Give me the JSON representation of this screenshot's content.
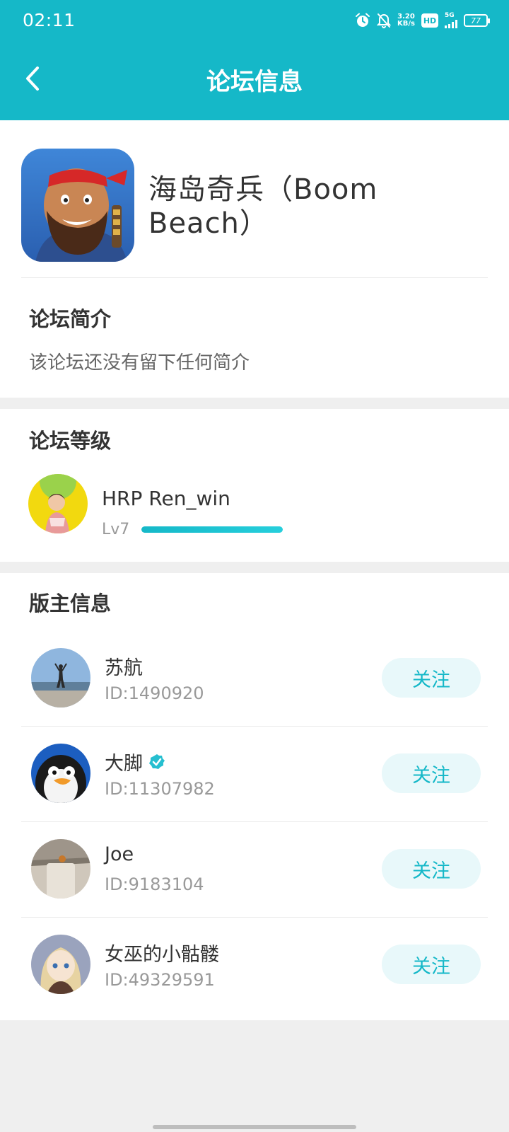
{
  "status_bar": {
    "time": "02:11",
    "net_speed_value": "3.20",
    "net_speed_unit": "KB/s",
    "hd_label": "HD",
    "signal_label": "5G",
    "battery": "77",
    "icons": [
      "alarm-icon",
      "bell-off-icon",
      "signal-icon",
      "battery-icon"
    ]
  },
  "header": {
    "title": "论坛信息",
    "back_icon": "chevron-left-icon"
  },
  "forum": {
    "name": "海岛奇兵（Boom Beach）",
    "intro_title": "论坛简介",
    "intro_text": "该论坛还没有留下任何简介"
  },
  "level": {
    "title": "论坛等级",
    "user_name": "HRP Ren_win",
    "level_label": "Lv7",
    "progress": 1.0
  },
  "moderators": {
    "title": "版主信息",
    "items": [
      {
        "name": "苏航",
        "id": "ID:1490920",
        "verified": false,
        "follow_label": "关注"
      },
      {
        "name": "大脚",
        "id": "ID:11307982",
        "verified": true,
        "follow_label": "关注"
      },
      {
        "name": "Joe",
        "id": "ID:9183104",
        "verified": false,
        "follow_label": "关注"
      },
      {
        "name": "女巫的小骷髅",
        "id": "ID:49329591",
        "verified": false,
        "follow_label": "关注"
      }
    ]
  },
  "colors": {
    "accent": "#15b8c8",
    "follow_bg": "#e8f8fa",
    "page_bg": "#efefef"
  }
}
